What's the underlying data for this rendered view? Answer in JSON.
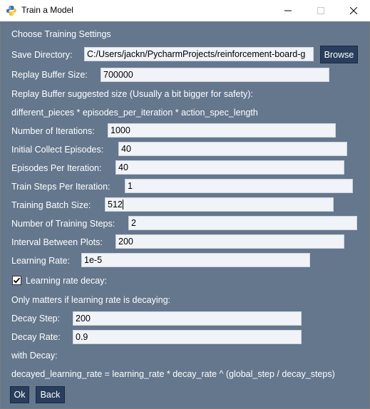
{
  "window": {
    "title": "Train a Model"
  },
  "colors": {
    "background": "#64778d",
    "button": "#283e5c",
    "input": "#f0f3f7"
  },
  "header": {
    "title": "Choose Training Settings"
  },
  "save_directory": {
    "label": "Save Directory:",
    "value": "C:/Users/jackn/PycharmProjects/reinforcement-board-g",
    "browse_label": "Browse"
  },
  "replay_buffer": {
    "label": "Replay Buffer Size:",
    "value": "700000",
    "hint": "Replay Buffer suggested size (Usually a bit bigger for safety):",
    "formula": "different_pieces * episodes_per_iteration * action_spec_length"
  },
  "fields": {
    "iterations": {
      "label": "Number of Iterations:",
      "value": "1000"
    },
    "initial_collect": {
      "label": "Initial Collect Episodes:",
      "value": "40"
    },
    "episodes_per_iteration": {
      "label": "Episodes Per Iteration:",
      "value": "40"
    },
    "train_steps": {
      "label": "Train Steps Per Iteration:",
      "value": "1"
    },
    "batch_size": {
      "label": "Training Batch Size:",
      "value": "512"
    },
    "training_steps": {
      "label": "Number of Training Steps:",
      "value": "2"
    },
    "plot_interval": {
      "label": "Interval Between Plots:",
      "value": "200"
    },
    "learning_rate": {
      "label": "Learning Rate:",
      "value": "1e-5"
    }
  },
  "decay": {
    "checkbox_label": "Learning rate decay:",
    "checked": true,
    "note": "Only matters if learning rate is decaying:",
    "step_label": "Decay Step:",
    "step_value": "200",
    "rate_label": "Decay Rate:",
    "rate_value": "0.9",
    "with_decay": "with Decay:",
    "formula": "decayed_learning_rate = learning_rate * decay_rate ^ (global_step / decay_steps)"
  },
  "footer": {
    "ok_label": "Ok",
    "back_label": "Back"
  }
}
